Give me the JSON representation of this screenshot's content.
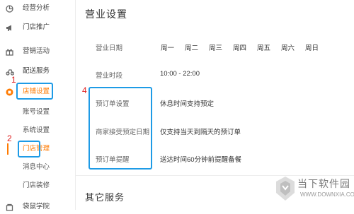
{
  "sidebar": {
    "items": [
      {
        "label": "经营分析",
        "icon": "analytics-icon"
      },
      {
        "label": "门店推广",
        "icon": "megaphone-icon"
      },
      {
        "label": "营销活动",
        "icon": "gift-icon"
      },
      {
        "label": "配送服务",
        "icon": "delivery-icon"
      },
      {
        "label": "店铺设置",
        "icon": "store-settings-icon"
      },
      {
        "label": "袋鼠学院",
        "icon": "academy-icon"
      }
    ],
    "sub_items": [
      {
        "label": "账号设置"
      },
      {
        "label": "系统设置"
      },
      {
        "label": "门店管理"
      },
      {
        "label": "消息中心"
      },
      {
        "label": "门店装修"
      }
    ]
  },
  "annotations": {
    "n1": "1",
    "n2": "2",
    "n4": "4"
  },
  "main": {
    "title": "营业设置",
    "business_date": {
      "label": "营业日期",
      "days": [
        "周一",
        "周二",
        "周三",
        "周四",
        "周五",
        "周六",
        "周日"
      ]
    },
    "business_hours": {
      "label": "营业时段",
      "value": "10:00 - 22:00"
    },
    "preorder_rows": [
      {
        "label": "预订单设置",
        "value": "休息时间支持预定"
      },
      {
        "label": "商家接受预定日期",
        "value": "仅支持当天到隔天的预订单"
      },
      {
        "label": "预订单提醒",
        "value": "送达时间60分钟前提醒备餐"
      }
    ],
    "other_services_title": "其它服务"
  },
  "watermark": {
    "name": "当下软件园",
    "url": "WWW.DOWNXIA.COM"
  },
  "colors": {
    "accent": "#ff7a00",
    "highlight_box": "#1e9be6",
    "annotation_red": "#e02020"
  }
}
